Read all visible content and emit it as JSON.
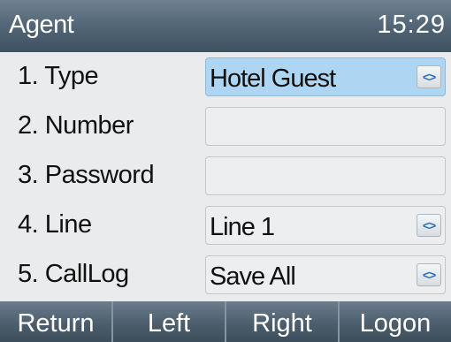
{
  "titlebar": {
    "title": "Agent",
    "clock": "15:29"
  },
  "rows": [
    {
      "label": "1. Type",
      "value": "Hotel Guest",
      "has_spinner": true,
      "selected": true
    },
    {
      "label": "2. Number",
      "value": "",
      "has_spinner": false,
      "selected": false
    },
    {
      "label": "3. Password",
      "value": "",
      "has_spinner": false,
      "selected": false
    },
    {
      "label": "4. Line",
      "value": "Line 1",
      "has_spinner": true,
      "selected": false
    },
    {
      "label": "5. CallLog",
      "value": "Save All",
      "has_spinner": true,
      "selected": false
    }
  ],
  "spinner_glyph": "<>",
  "softkeys": [
    "Return",
    "Left",
    "Right",
    "Logon"
  ],
  "colors": {
    "titlebar": "#4f6374",
    "selected_field": "#aed6f2",
    "spinner_arrow": "#2e6fb3"
  }
}
